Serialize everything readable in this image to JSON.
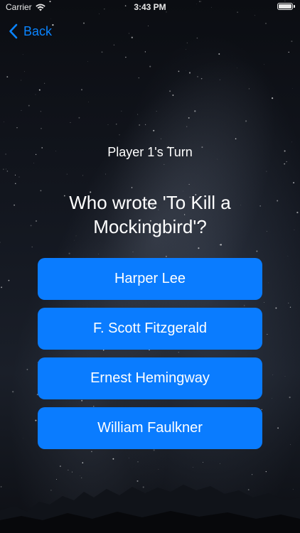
{
  "status_bar": {
    "carrier": "Carrier",
    "time": "3:43 PM"
  },
  "nav": {
    "back_label": "Back"
  },
  "game": {
    "turn": "Player 1's Turn",
    "question": "Who wrote 'To Kill a Mockingbird'?",
    "answers": [
      "Harper Lee",
      "F. Scott Fitzgerald",
      "Ernest Hemingway",
      "William Faulkner"
    ]
  },
  "colors": {
    "accent": "#0a84ff",
    "answer_button": "#0a7cff"
  }
}
